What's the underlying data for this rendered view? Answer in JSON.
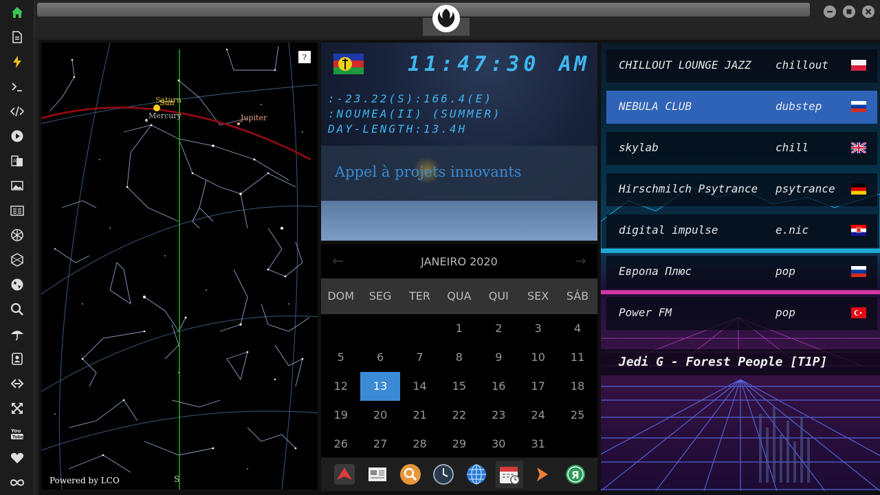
{
  "sidebar": {
    "items": [
      "home-icon",
      "document-icon",
      "lightning-icon",
      "terminal-icon",
      "code-icon",
      "play-icon",
      "translate-icon",
      "image-icon",
      "news-icon",
      "atom-icon",
      "hexagon-icon",
      "globe-icon",
      "search-icon",
      "umbrella-icon",
      "contacts-icon",
      "link-icon",
      "expand-icon",
      "youtube-icon",
      "heart-icon",
      "infinity-icon"
    ]
  },
  "starmap": {
    "help_label": "?",
    "powered_by": "Powered by LCO",
    "south_label": "S",
    "planets": {
      "saturn": "Saturn",
      "sun": "Sun",
      "mercury": "Mercury",
      "jupiter": "Jupiter"
    }
  },
  "clock": {
    "time": "11:47:30",
    "ampm": "AM",
    "coords": ":-23.22(S):166.4(E)",
    "city": ":NOUMEA(II) (SUMMER)",
    "day_length": "DAY-LENGTH:13.4H",
    "banner": "Appel à projets innovants"
  },
  "calendar": {
    "month": "JANEIRO 2020",
    "prev": "←",
    "next": "→",
    "days_of_week": [
      "DOM",
      "SEG",
      "TER",
      "QUA",
      "QUI",
      "SEX",
      "SÁB"
    ],
    "dates": [
      "1",
      "2",
      "3",
      "4",
      "5",
      "6",
      "7",
      "8",
      "9",
      "10",
      "11",
      "12",
      "13",
      "14",
      "15",
      "16",
      "17",
      "18",
      "19",
      "20",
      "21",
      "22",
      "23",
      "24",
      "25",
      "26",
      "27",
      "28",
      "29",
      "30",
      "31"
    ],
    "today": "13"
  },
  "dock": {
    "items": [
      "arrow-app-icon",
      "newspaper-icon",
      "magnifier-icon",
      "clock-icon",
      "globe-icon",
      "calendar-icon",
      "play-arrow-icon",
      "yandex-icon"
    ]
  },
  "radio": {
    "stations": [
      {
        "name": "CHILLOUT LOUNGE JAZZ",
        "genre": "chillout",
        "flag": "poland-flag"
      },
      {
        "name": "NEBULA CLUB",
        "genre": "dubstep",
        "flag": "russia-flag"
      },
      {
        "name": "skylab",
        "genre": "chill",
        "flag": "uk-flag"
      },
      {
        "name": "Hirschmilch Psytrance",
        "genre": "psytrance",
        "flag": "germany-flag"
      },
      {
        "name": "digital impulse",
        "genre": "e.nic",
        "flag": "croatia-flag"
      },
      {
        "name": "Европа Плюс",
        "genre": "pop",
        "flag": "russia-flag"
      },
      {
        "name": "Power FM",
        "genre": "pop",
        "flag": "turkey-flag"
      }
    ],
    "now_playing": "Jedi G - Forest People [T1P]"
  }
}
